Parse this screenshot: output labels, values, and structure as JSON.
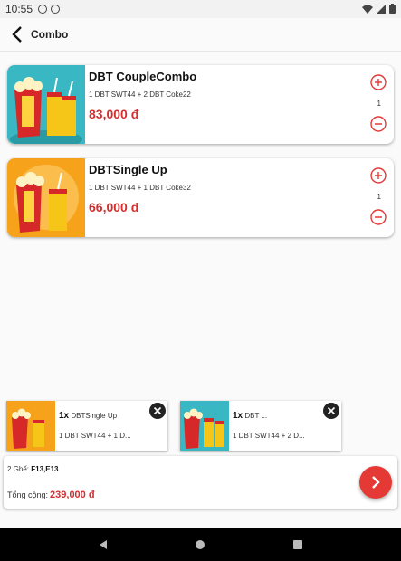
{
  "status_bar": {
    "time": "10:55"
  },
  "app_bar": {
    "title": "Combo"
  },
  "combos": [
    {
      "name": "DBT CoupleCombo",
      "description": "1 DBT SWT44 + 2 DBT Coke22",
      "price": "83,000 đ",
      "quantity": "1"
    },
    {
      "name": "DBTSingle Up",
      "description": "1 DBT SWT44 + 1 DBT Coke32",
      "price": "66,000 đ",
      "quantity": "1"
    }
  ],
  "selected": [
    {
      "qty": "1x",
      "name": "DBTSingle Up",
      "description": "1 DBT SWT44 + 1 D..."
    },
    {
      "qty": "1x",
      "name": "DBT ...",
      "description": "1 DBT SWT44 + 2 D..."
    }
  ],
  "summary": {
    "seats_label": "2 Ghế:",
    "seats_value": "F13,E13",
    "total_label": "Tổng cộng:",
    "total_value": "239,000 đ"
  },
  "colors": {
    "accent": "#d32f2f",
    "next_button": "#e53935",
    "teal_bg": "#39b8c3",
    "orange_bg": "#f7a21b"
  },
  "icons": [
    "back-arrow-icon",
    "plus-circle-icon",
    "minus-circle-icon",
    "close-icon",
    "chevron-right-icon"
  ]
}
